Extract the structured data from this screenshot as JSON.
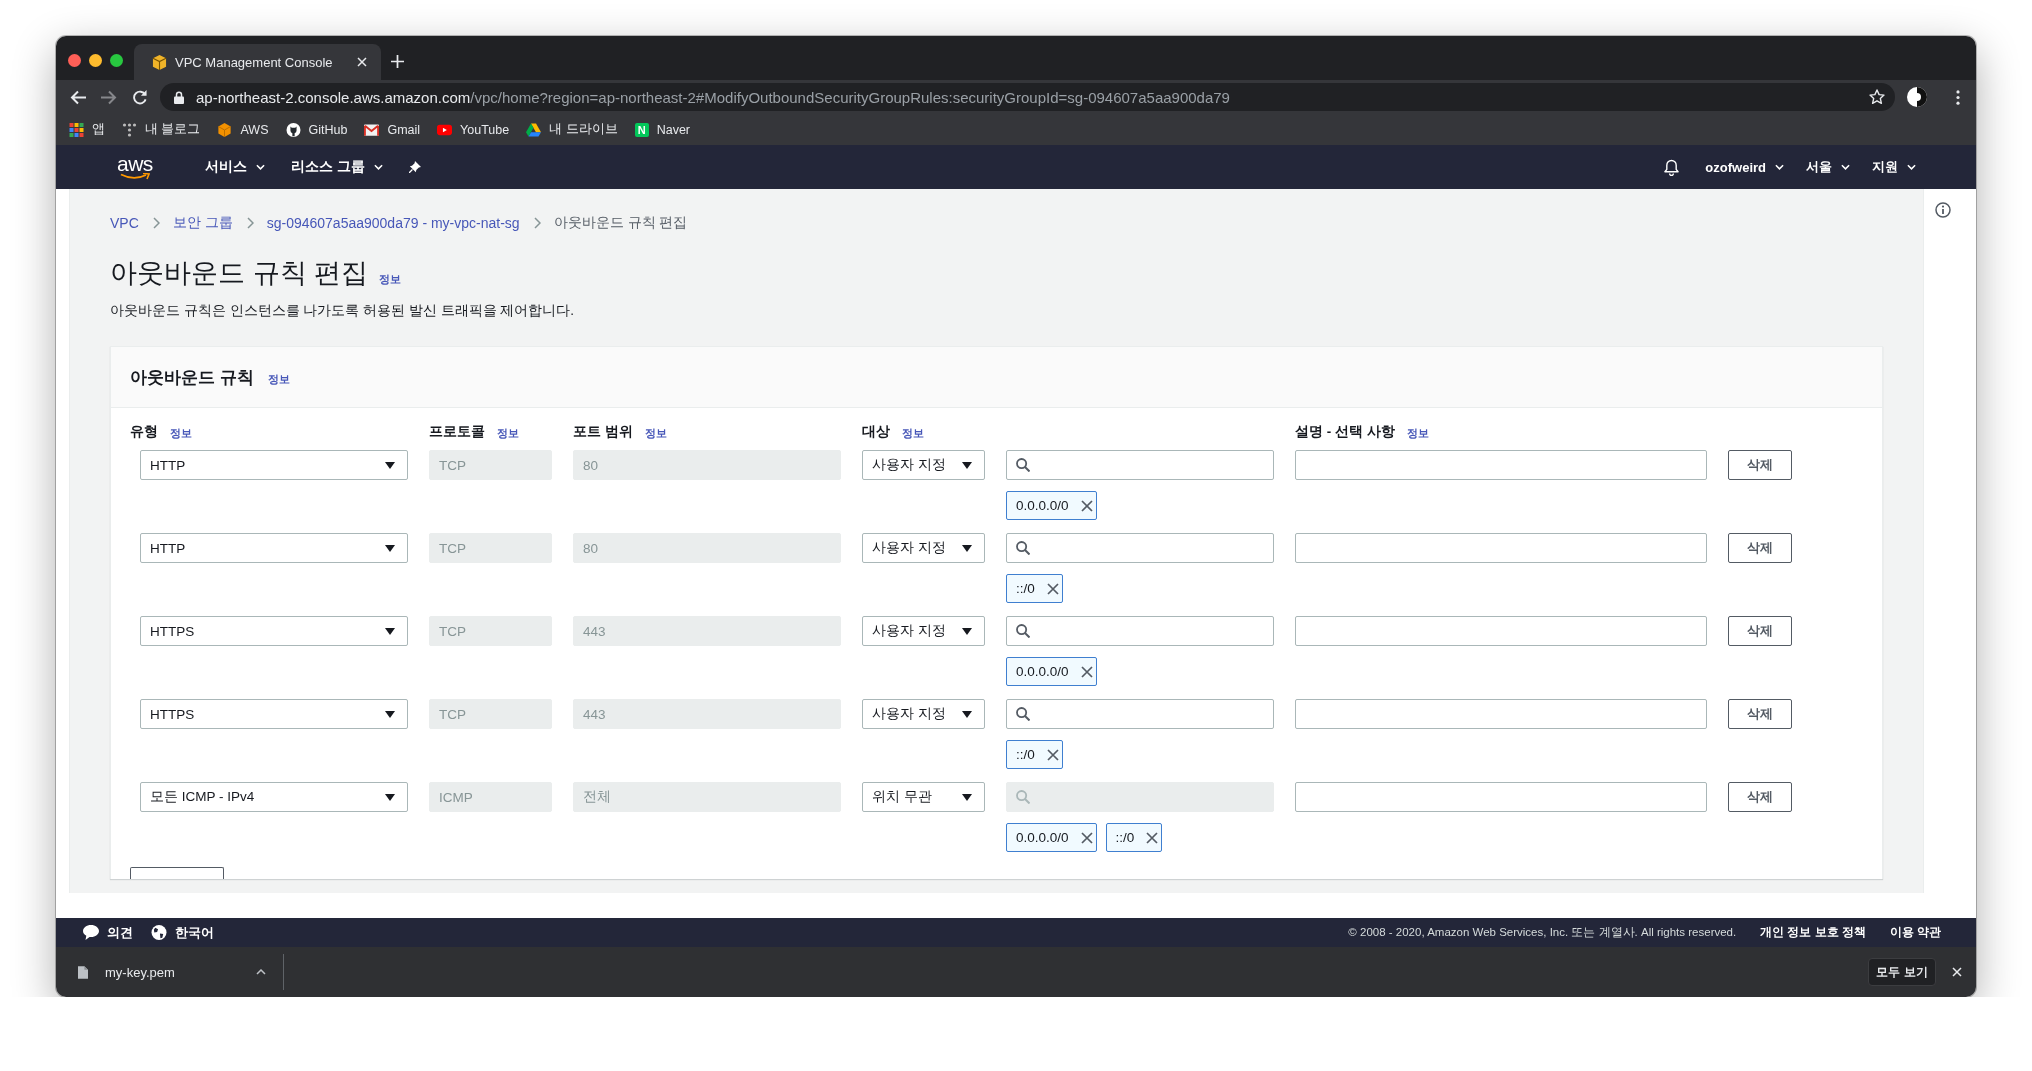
{
  "browser": {
    "tab": {
      "title": "VPC Management Console"
    },
    "forward_disabled": true,
    "url": {
      "host": "ap-northeast-2.console.aws.amazon.com",
      "path": "/vpc/home?region=ap-northeast-2#ModifyOutboundSecurityGroupRules:securityGroupId=sg-094607a5aa900da79"
    },
    "bookmarks": [
      {
        "kind": "apps",
        "label": "앱"
      },
      {
        "kind": "blog",
        "label": "내 블로그"
      },
      {
        "kind": "aws",
        "label": "AWS"
      },
      {
        "kind": "github",
        "label": "GitHub"
      },
      {
        "kind": "gmail",
        "label": "Gmail"
      },
      {
        "kind": "youtube",
        "label": "YouTube"
      },
      {
        "kind": "drive",
        "label": "내 드라이브"
      },
      {
        "kind": "naver",
        "label": "Naver",
        "logo_text": "N"
      }
    ]
  },
  "navbar": {
    "logo": "aws",
    "menus": [
      "서비스",
      "리소스 그룹"
    ],
    "account_menus": [
      "ozofweird",
      "서울",
      "지원"
    ]
  },
  "breadcrumb": [
    {
      "label": "VPC",
      "link": true
    },
    {
      "label": "보안 그룹",
      "link": true
    },
    {
      "label": "sg-094607a5aa900da79 - my-vpc-nat-sg",
      "link": true
    },
    {
      "label": "아웃바운드 규칙 편집",
      "link": false
    }
  ],
  "page": {
    "title": "아웃바운드 규칙 편집",
    "info": "정보",
    "description": "아웃바운드 규칙은 인스턴스를 나가도록 허용된 발신 트래픽을 제어합니다."
  },
  "rules_panel": {
    "title": "아웃바운드 규칙",
    "info": "정보",
    "columns": [
      {
        "label": "유형",
        "info": "정보"
      },
      {
        "label": "프로토콜",
        "info": "정보"
      },
      {
        "label": "포트 범위",
        "info": "정보"
      },
      {
        "label": "대상",
        "info": "정보"
      },
      {
        "label": "설명 - 선택 사항",
        "info": "정보"
      }
    ],
    "rules": [
      {
        "type": "HTTP",
        "protocol": "TCP",
        "port_range": "80",
        "destination": "사용자 지정",
        "search_disabled": false,
        "cidrs": [
          "0.0.0.0/0"
        ],
        "delete_label": "삭제"
      },
      {
        "type": "HTTP",
        "protocol": "TCP",
        "port_range": "80",
        "destination": "사용자 지정",
        "search_disabled": false,
        "cidrs": [
          "::/0"
        ],
        "delete_label": "삭제"
      },
      {
        "type": "HTTPS",
        "protocol": "TCP",
        "port_range": "443",
        "destination": "사용자 지정",
        "search_disabled": false,
        "cidrs": [
          "0.0.0.0/0"
        ],
        "delete_label": "삭제"
      },
      {
        "type": "HTTPS",
        "protocol": "TCP",
        "port_range": "443",
        "destination": "사용자 지정",
        "search_disabled": false,
        "cidrs": [
          "::/0"
        ],
        "delete_label": "삭제"
      },
      {
        "type": "모든 ICMP - IPv4",
        "protocol": "ICMP",
        "port_range": "전체",
        "destination": "위치 무관",
        "search_disabled": true,
        "cidrs": [
          "0.0.0.0/0",
          "::/0"
        ],
        "delete_label": "삭제"
      }
    ]
  },
  "footer": {
    "feedback": "의견",
    "language": "한국어",
    "copyright": "© 2008 - 2020, Amazon Web Services, Inc. 또는 계열사. All rights reserved.",
    "links": [
      "개인 정보 보호 정책",
      "이용 약관"
    ]
  },
  "download_bar": {
    "file": "my-key.pem",
    "show_all": "모두 보기"
  }
}
